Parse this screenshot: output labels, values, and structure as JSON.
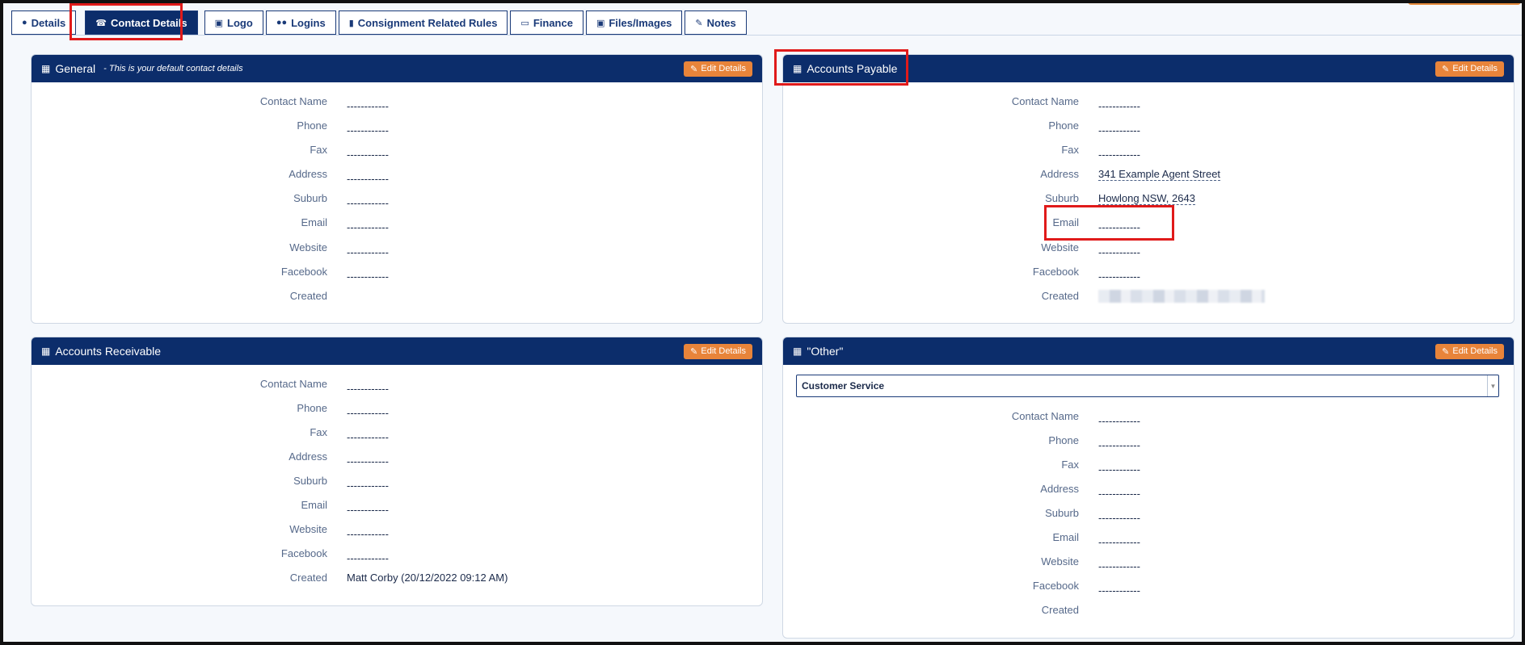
{
  "tabs": [
    {
      "label": "Details",
      "icon": "user-icon"
    },
    {
      "label": "Contact Details",
      "icon": "phone-icon"
    },
    {
      "label": "Logo",
      "icon": "image-icon"
    },
    {
      "label": "Logins",
      "icon": "users-icon"
    },
    {
      "label": "Consignment Related Rules",
      "icon": "file-icon"
    },
    {
      "label": "Finance",
      "icon": "folder-open-icon"
    },
    {
      "label": "Files/Images",
      "icon": "file-image-icon"
    },
    {
      "label": "Notes",
      "icon": "pencil-icon"
    }
  ],
  "active_tab": "Contact Details",
  "edit_label": "Edit Details",
  "dash": "------------",
  "fields": [
    "Contact Name",
    "Phone",
    "Fax",
    "Address",
    "Suburb",
    "Email",
    "Website",
    "Facebook",
    "Created"
  ],
  "general": {
    "title": "General",
    "subtitle": "- This is your default contact details",
    "created": ""
  },
  "payable": {
    "title": "Accounts Payable",
    "address": "341 Example Agent Street",
    "suburb": "Howlong NSW, 2643"
  },
  "receivable": {
    "title": "Accounts Receivable",
    "created": "Matt Corby (20/12/2022 09:12 AM)"
  },
  "other": {
    "title": "\"Other\"",
    "selected": "Customer Service"
  },
  "colors": {
    "header": "#0c2d6b",
    "accent": "#e8843a",
    "highlight": "#e01a1a"
  }
}
